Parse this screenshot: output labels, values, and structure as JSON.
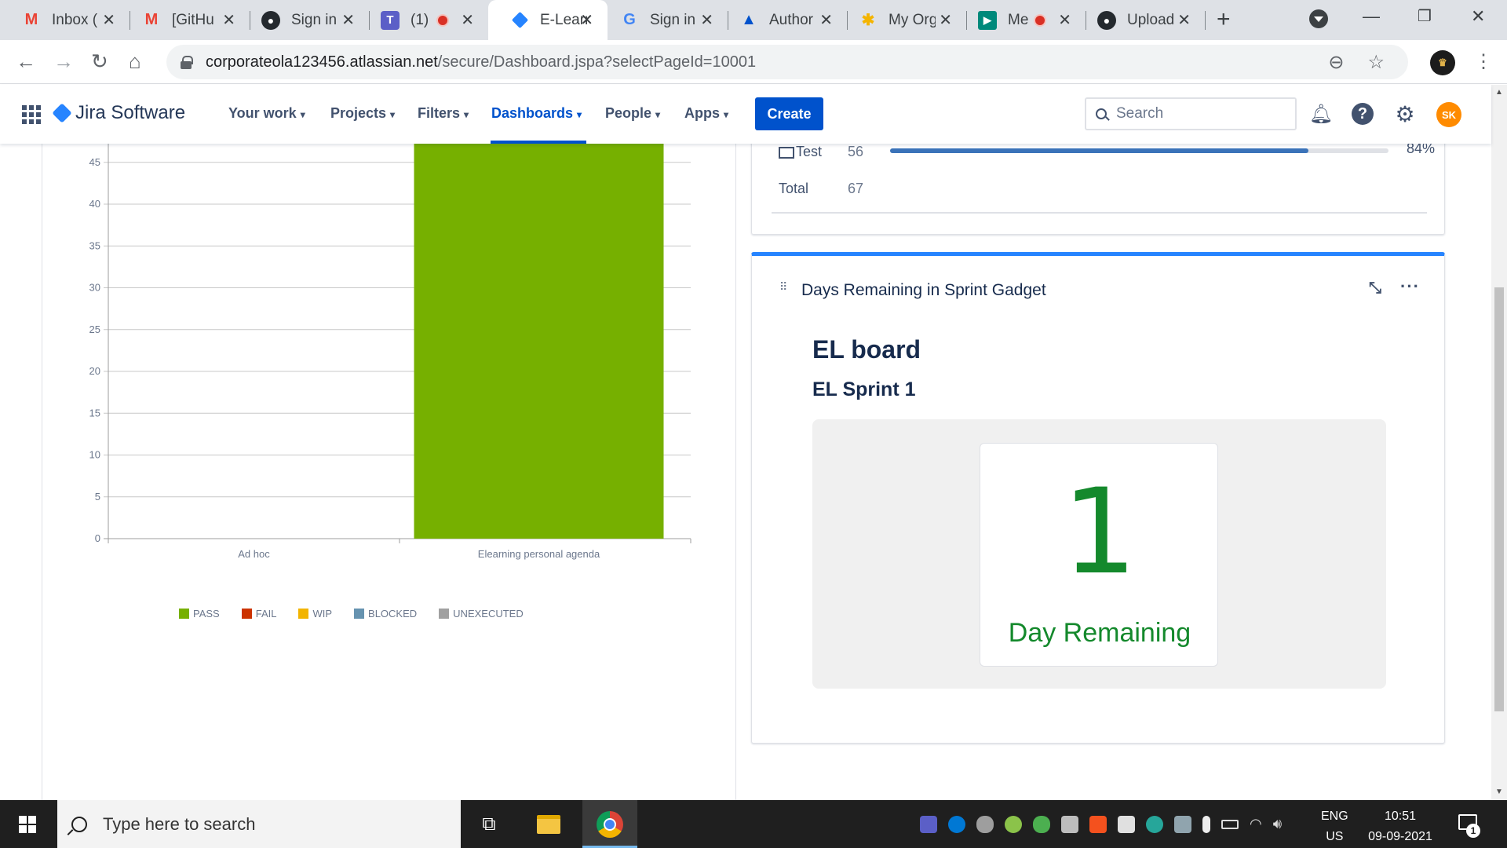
{
  "browser": {
    "tabs": [
      {
        "title": "Inbox (",
        "icon": "gmail-icon"
      },
      {
        "title": "[GitHu",
        "icon": "gmail-icon"
      },
      {
        "title": "Sign in",
        "icon": "github-icon"
      },
      {
        "title": "(1)",
        "icon": "teams-icon",
        "recording": true
      },
      {
        "title": "E-Learn",
        "icon": "jira-icon",
        "active": true
      },
      {
        "title": "Sign in",
        "icon": "google-icon"
      },
      {
        "title": "Author",
        "icon": "atlassian-icon"
      },
      {
        "title": "My Org",
        "icon": "pinwheel-icon"
      },
      {
        "title": "Me",
        "icon": "meet-icon",
        "recording": true
      },
      {
        "title": "Upload",
        "icon": "github-icon"
      }
    ],
    "url_host": "corporateola123456.atlassian.net",
    "url_path": "/secure/Dashboard.jspa?selectPageId=10001"
  },
  "jira": {
    "brand": "Jira Software",
    "nav": [
      {
        "label": "Your work"
      },
      {
        "label": "Projects"
      },
      {
        "label": "Filters"
      },
      {
        "label": "Dashboards",
        "active": true
      },
      {
        "label": "People"
      },
      {
        "label": "Apps"
      }
    ],
    "create_label": "Create",
    "search_placeholder": "Search",
    "user_initials": "SK"
  },
  "chart_data": {
    "type": "bar",
    "stacked": true,
    "categories": [
      "Ad hoc",
      "Elearning personal agenda"
    ],
    "series": [
      {
        "name": "PASS",
        "color": "#76b000",
        "values": [
          0,
          56
        ]
      },
      {
        "name": "FAIL",
        "color": "#cc3300",
        "values": [
          0,
          0
        ]
      },
      {
        "name": "WIP",
        "color": "#f2b400",
        "values": [
          0,
          0
        ]
      },
      {
        "name": "BLOCKED",
        "color": "#6693b0",
        "values": [
          0,
          0
        ]
      },
      {
        "name": "UNEXECUTED",
        "color": "#a0a0a0",
        "values": [
          0,
          0
        ]
      }
    ],
    "y_ticks": [
      0,
      5,
      10,
      15,
      20,
      25,
      30,
      35,
      40,
      45
    ],
    "grid": true,
    "legend_position": "bottom"
  },
  "test_summary": {
    "rows": [
      {
        "label": "Test",
        "count": "56",
        "percent": "84%",
        "progress": 0.84
      }
    ],
    "total_label": "Total",
    "total_count": "67"
  },
  "gadget": {
    "title": "Days Remaining in Sprint Gadget",
    "board": "EL board",
    "sprint": "EL Sprint 1",
    "days": "1",
    "days_label": "Day Remaining"
  },
  "taskbar": {
    "search_placeholder": "Type here to search",
    "lang_top": "ENG",
    "lang_bottom": "US",
    "time": "10:51",
    "date": "09-09-2021",
    "notification_count": "1"
  }
}
